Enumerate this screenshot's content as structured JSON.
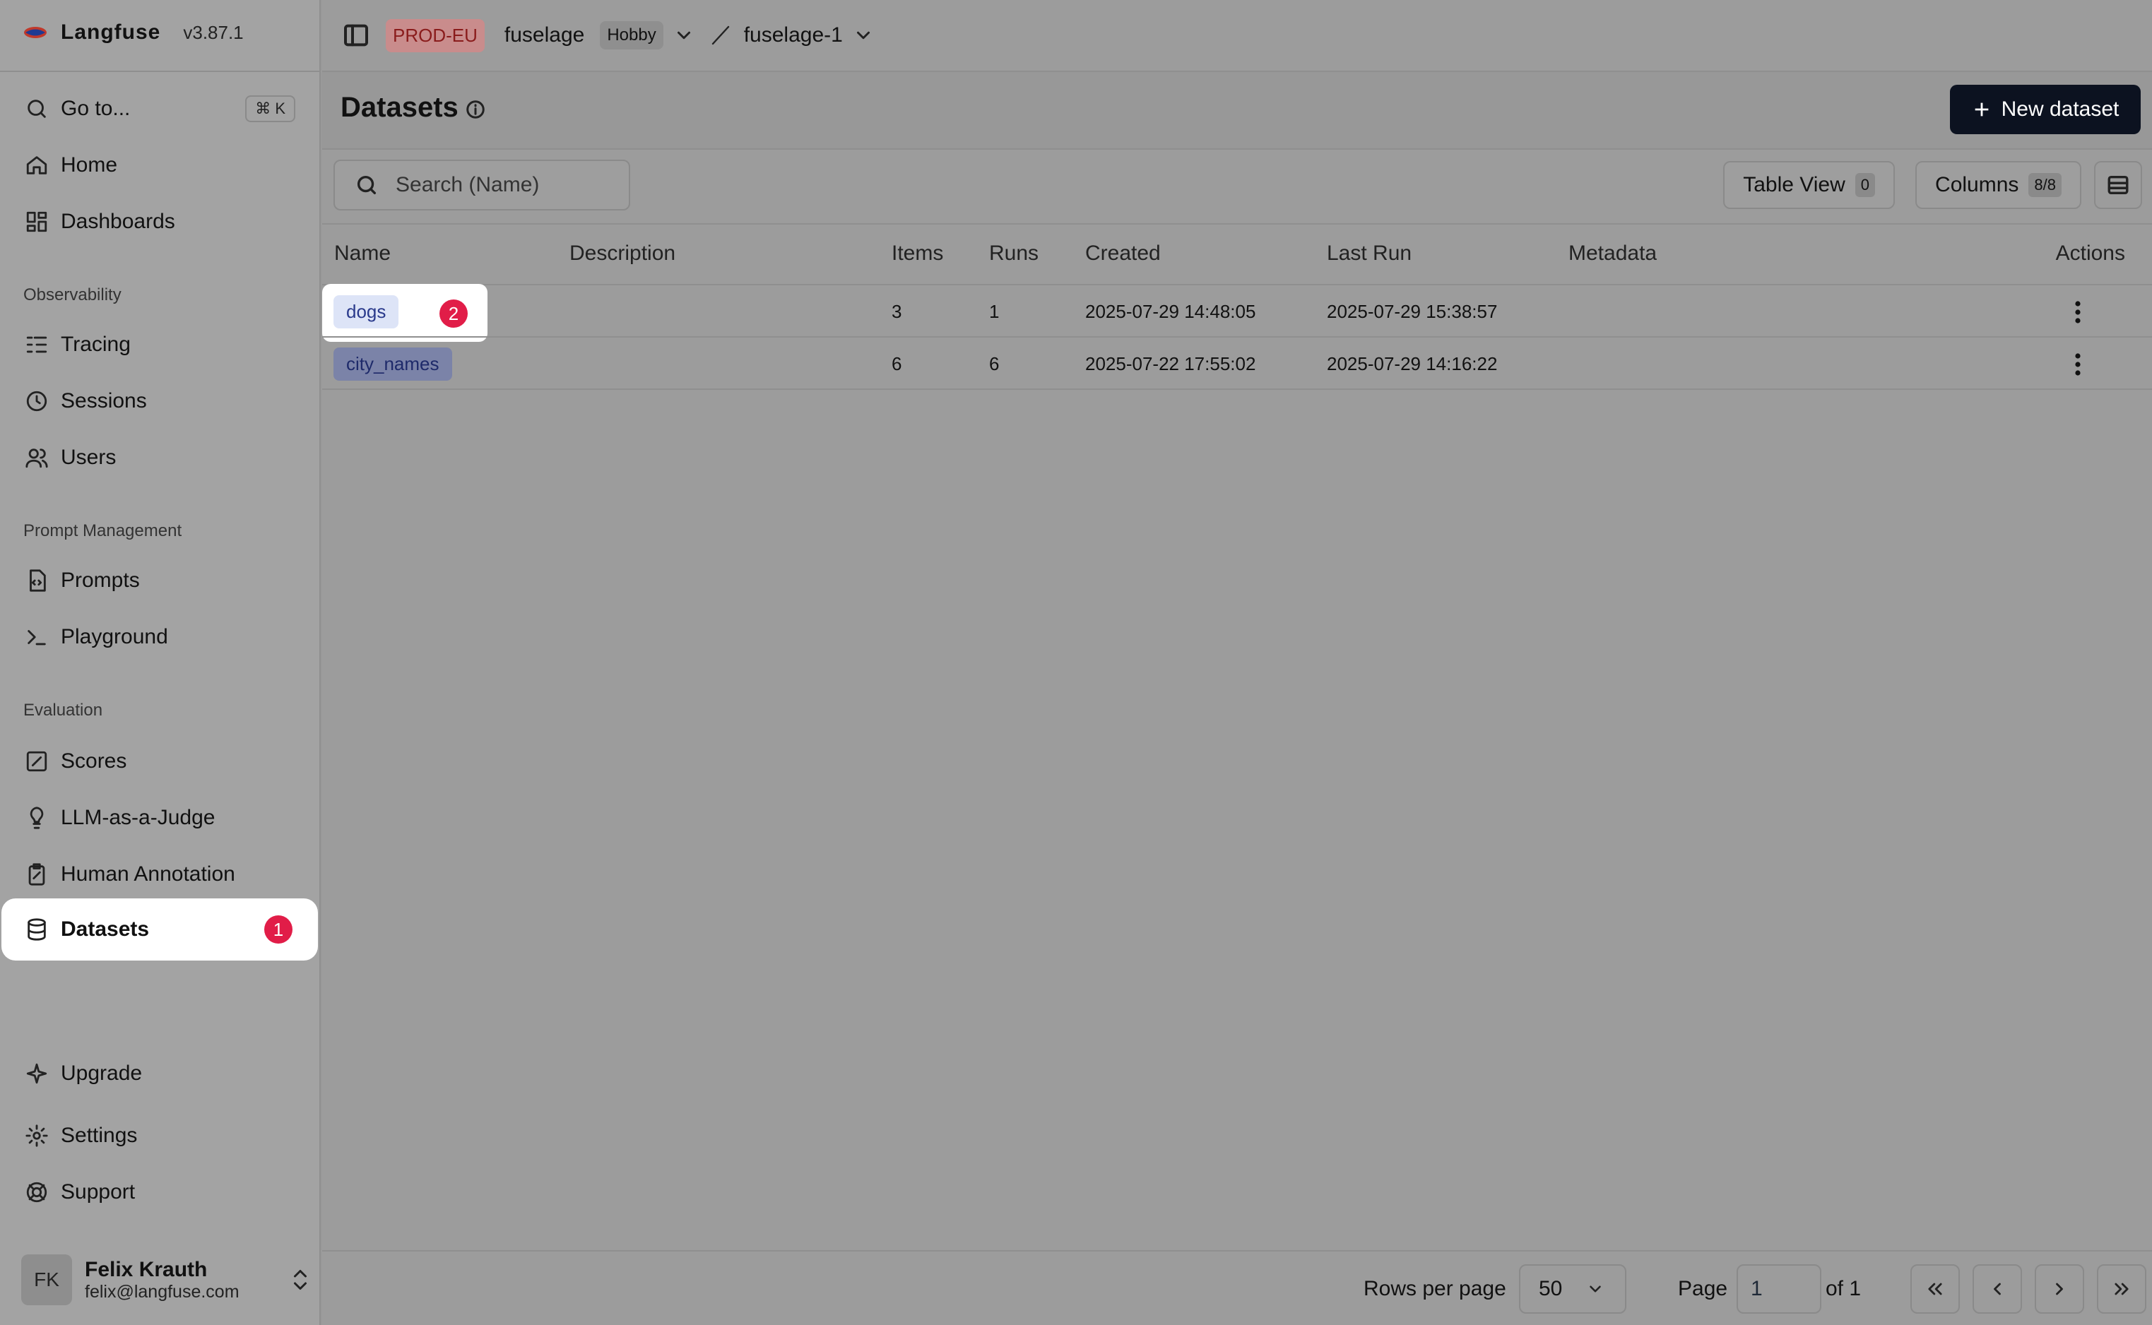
{
  "app": {
    "name": "Langfuse",
    "version": "v3.87.1"
  },
  "header": {
    "env": "PROD-EU",
    "org": "fuselage",
    "plan": "Hobby",
    "project": "fuselage-1"
  },
  "sidebar": {
    "goto": {
      "label": "Go to...",
      "shortcut": "⌘ K"
    },
    "home": "Home",
    "dashboards": "Dashboards",
    "section_observability": "Observability",
    "tracing": "Tracing",
    "sessions": "Sessions",
    "users": "Users",
    "section_prompt": "Prompt Management",
    "prompts": "Prompts",
    "playground": "Playground",
    "section_eval": "Evaluation",
    "scores": "Scores",
    "judge": "LLM-as-a-Judge",
    "annotation": "Human Annotation",
    "datasets": "Datasets",
    "datasets_badge": "1",
    "upgrade": "Upgrade",
    "settings": "Settings",
    "support": "Support"
  },
  "user": {
    "initials": "FK",
    "name": "Felix Krauth",
    "email": "felix@langfuse.com"
  },
  "page": {
    "title": "Datasets",
    "new_button": "New dataset"
  },
  "toolbar": {
    "search_placeholder": "Search (Name)",
    "table_view": "Table View",
    "table_view_count": "0",
    "columns": "Columns",
    "columns_count": "8/8"
  },
  "table": {
    "headers": {
      "name": "Name",
      "description": "Description",
      "items": "Items",
      "runs": "Runs",
      "created": "Created",
      "last_run": "Last Run",
      "metadata": "Metadata",
      "actions": "Actions"
    },
    "rows": [
      {
        "name": "dogs",
        "badge": "2",
        "description": "",
        "items": "3",
        "runs": "1",
        "created": "2025-07-29 14:48:05",
        "last_run": "2025-07-29 15:38:57",
        "metadata": ""
      },
      {
        "name": "city_names",
        "description": "",
        "items": "6",
        "runs": "6",
        "created": "2025-07-22 17:55:02",
        "last_run": "2025-07-29 14:16:22",
        "metadata": ""
      }
    ]
  },
  "footer": {
    "rows_per_page_label": "Rows per page",
    "rows_per_page": "50",
    "page_label": "Page",
    "page": "1",
    "of_label": "of 1"
  }
}
